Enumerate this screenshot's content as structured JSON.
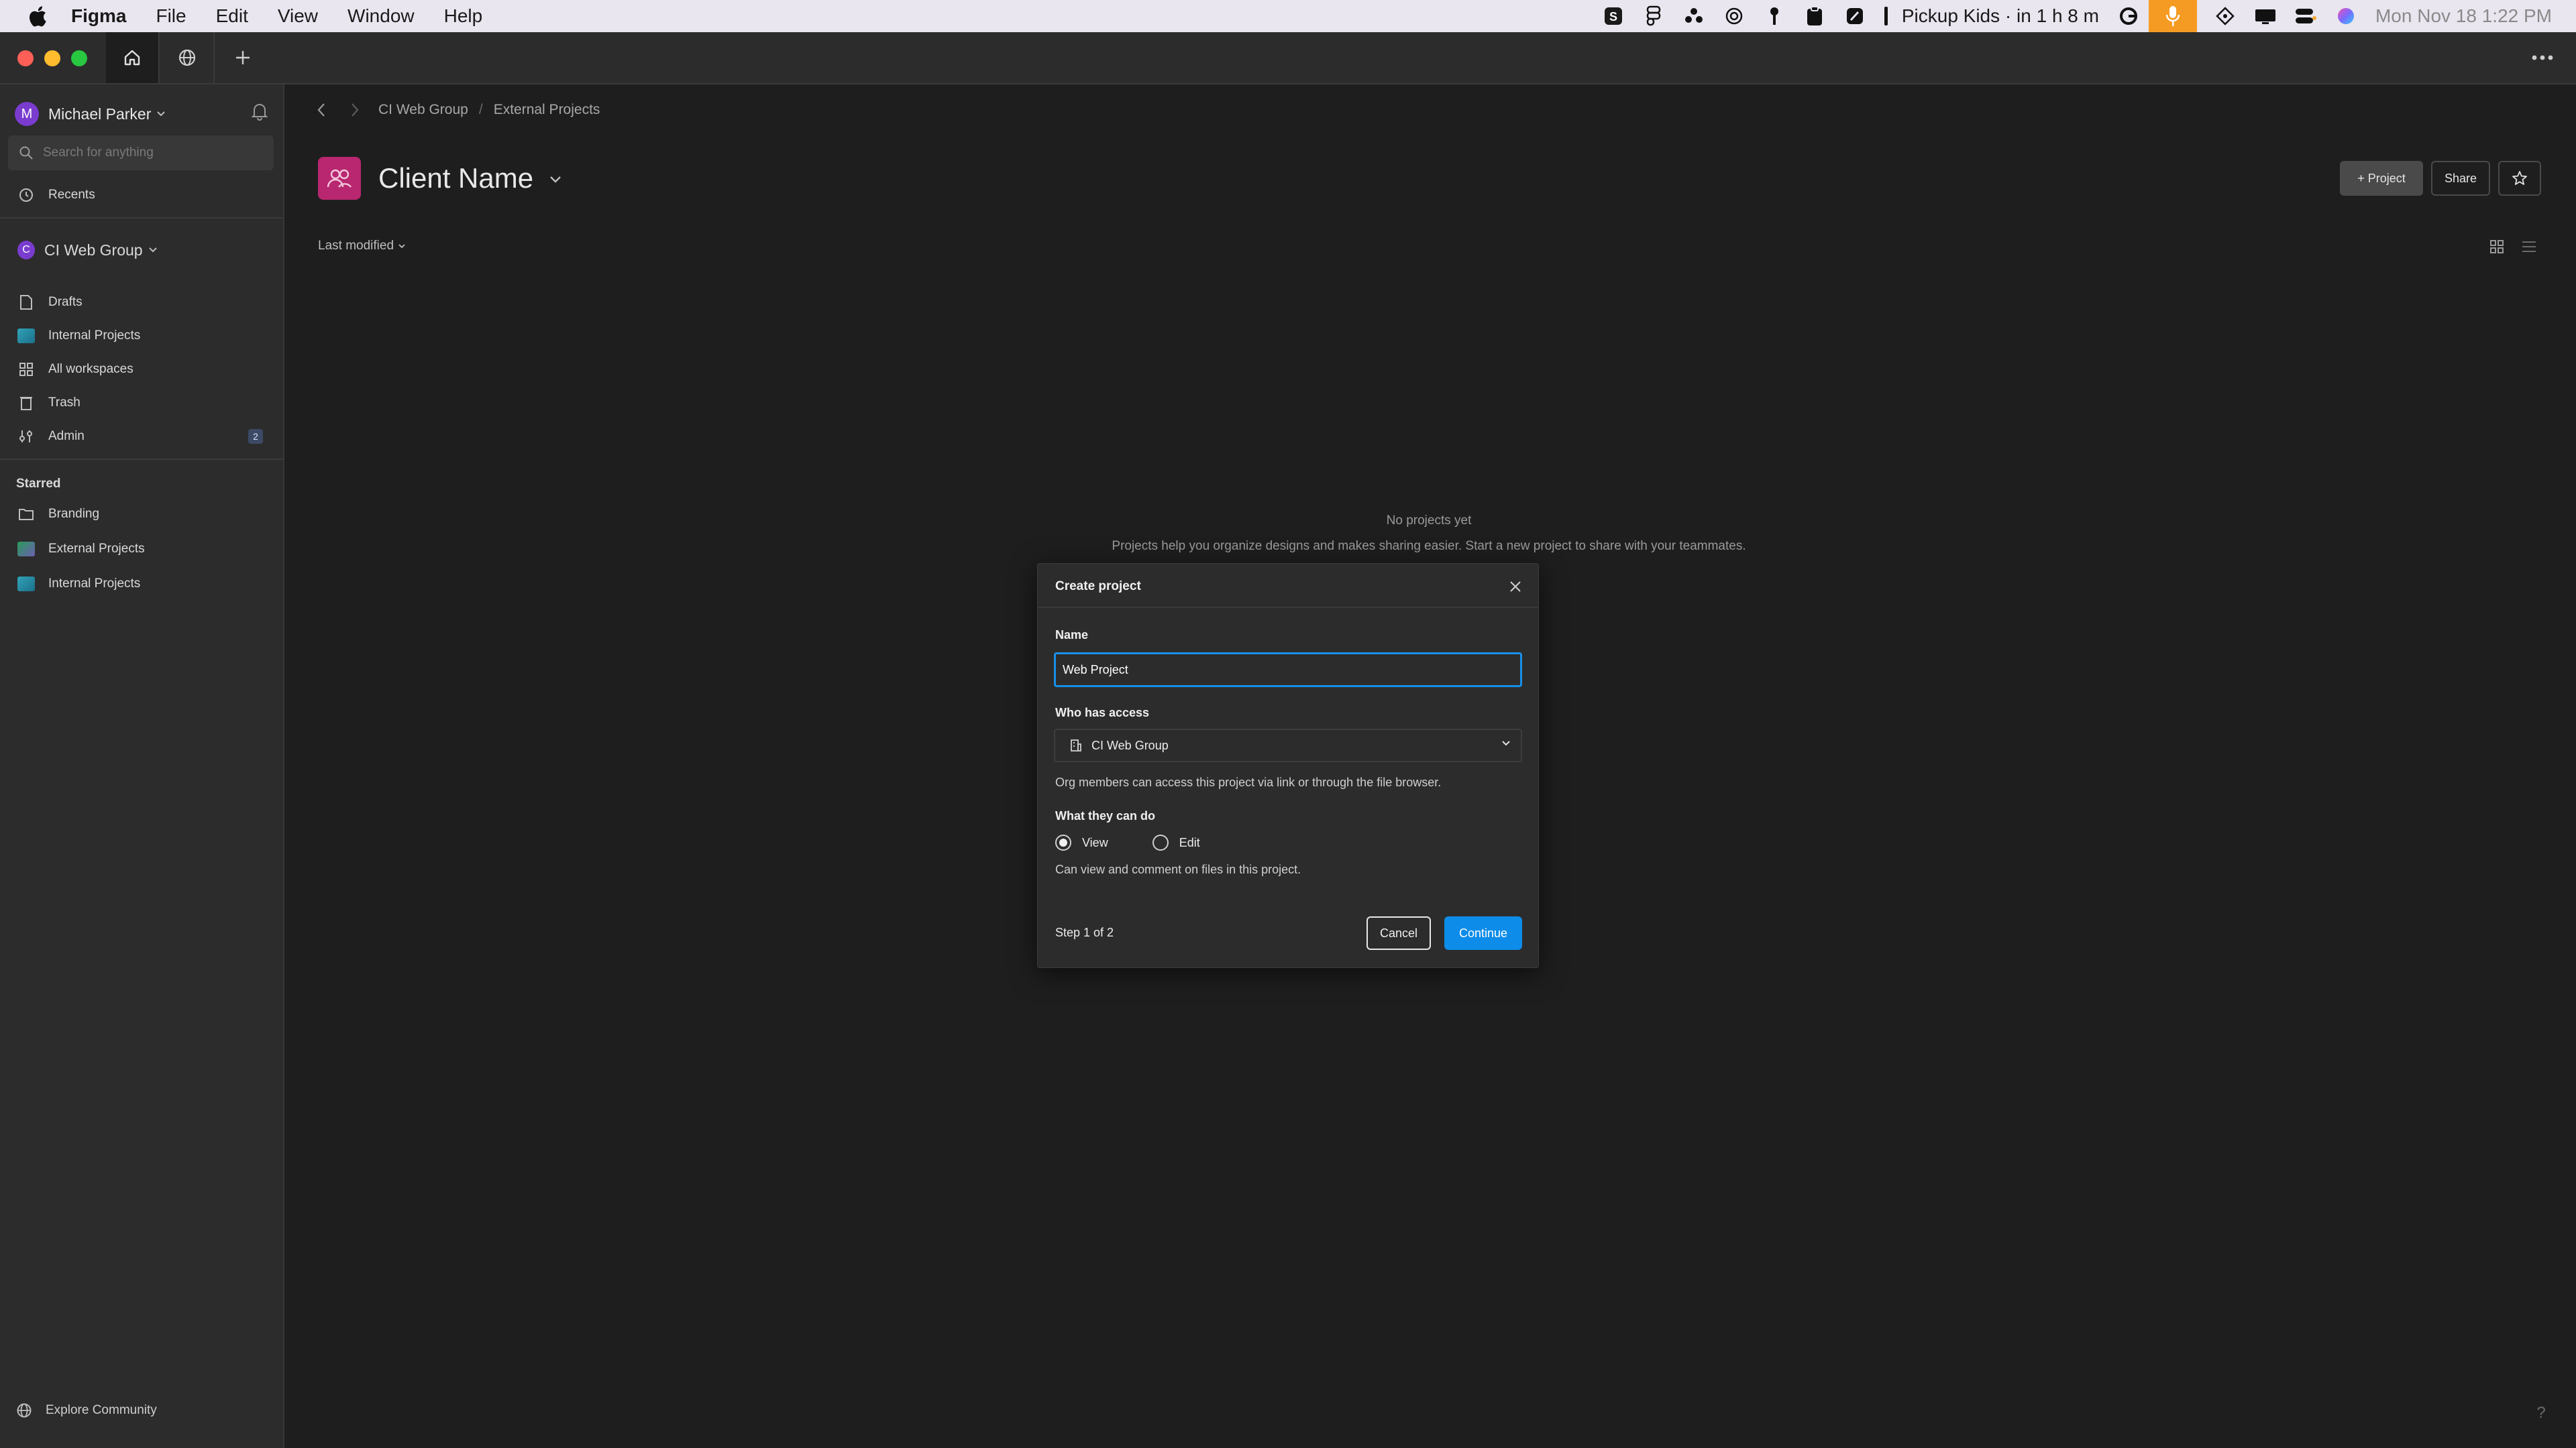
{
  "menubar": {
    "app_name": "Figma",
    "menus": [
      "File",
      "Edit",
      "View",
      "Window",
      "Help"
    ],
    "calendar_event": "Pickup Kids · in 1 h 8 m",
    "clock": "Mon Nov 18  1:22 PM"
  },
  "sidebar": {
    "user_name": "Michael Parker",
    "user_initial": "M",
    "search_placeholder": "Search for anything",
    "recents": "Recents",
    "org_name": "CI Web Group",
    "org_initial": "C",
    "items": [
      {
        "label": "Drafts"
      },
      {
        "label": "Internal Projects"
      },
      {
        "label": "All workspaces"
      },
      {
        "label": "Trash"
      },
      {
        "label": "Admin",
        "badge": "2"
      }
    ],
    "starred_title": "Starred",
    "starred": [
      {
        "label": "Branding"
      },
      {
        "label": "External Projects"
      },
      {
        "label": "Internal Projects"
      }
    ],
    "explore": "Explore Community"
  },
  "main": {
    "breadcrumb": [
      "CI Web Group",
      "External Projects"
    ],
    "title": "Client Name",
    "buttons": {
      "project": "+ Project",
      "share": "Share"
    },
    "sort_label": "Last modified",
    "empty_title": "No projects yet",
    "empty_desc": "Projects help you organize designs and makes sharing easier. Start a new project to share with your teammates."
  },
  "dialog": {
    "title": "Create project",
    "name_label": "Name",
    "name_value": "Web Project",
    "access_label": "Who has access",
    "access_value": "CI Web Group",
    "access_help": "Org members can access this project via link or through the file browser.",
    "permission_label": "What they can do",
    "options": [
      "View",
      "Edit"
    ],
    "selected": "View",
    "permission_help": "Can view and comment on files in this project.",
    "step": "Step 1 of 2",
    "cancel": "Cancel",
    "continue": "Continue"
  },
  "colors": {
    "accent": "#0d8ce9",
    "team_icon": "#b8276f",
    "mic_tray": "#f59b23"
  }
}
